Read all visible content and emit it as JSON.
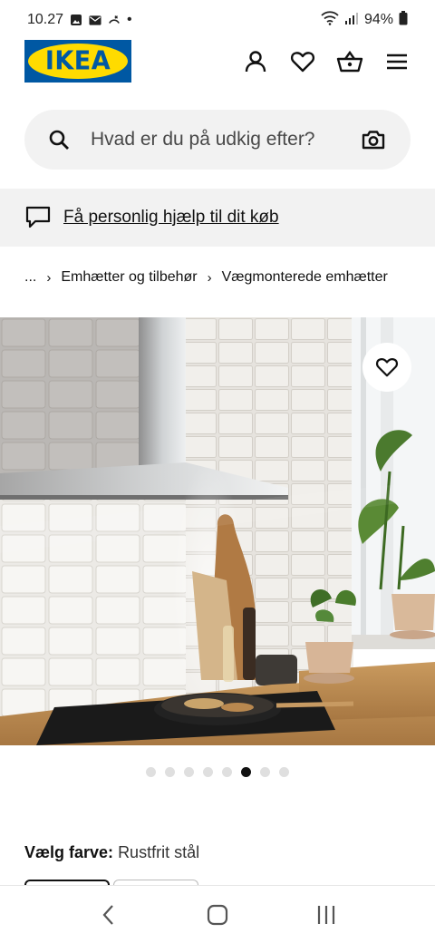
{
  "status_bar": {
    "time": "10.27",
    "battery": "94%",
    "dot": "•",
    "icons": [
      "image-icon",
      "mail-icon",
      "missed-call-icon",
      "wifi-icon",
      "signal-icon",
      "battery-icon"
    ]
  },
  "header": {
    "logo_text": "IKEA",
    "icons": [
      "user-icon",
      "heart-icon",
      "basket-icon",
      "menu-icon"
    ],
    "brand_colors": {
      "blue": "#0058a3",
      "yellow": "#ffdb00"
    }
  },
  "search": {
    "placeholder": "Hvad er du på udkig efter?",
    "icons": [
      "search-icon",
      "camera-icon"
    ]
  },
  "help_banner": {
    "link_text": "Få personlig hjælp til dit køb",
    "icon": "chat-icon"
  },
  "breadcrumb": {
    "ellipsis": "...",
    "items": [
      "Emhætter og tilbehør",
      "Vægmonterede emhætter"
    ],
    "separator": "›"
  },
  "carousel": {
    "total": 8,
    "active_index": 5
  },
  "color_select": {
    "label": "Vælg farve:",
    "value": "Rustfrit stål"
  },
  "nav_bar": {
    "icons": [
      "back-icon",
      "home-icon",
      "recents-icon"
    ]
  }
}
